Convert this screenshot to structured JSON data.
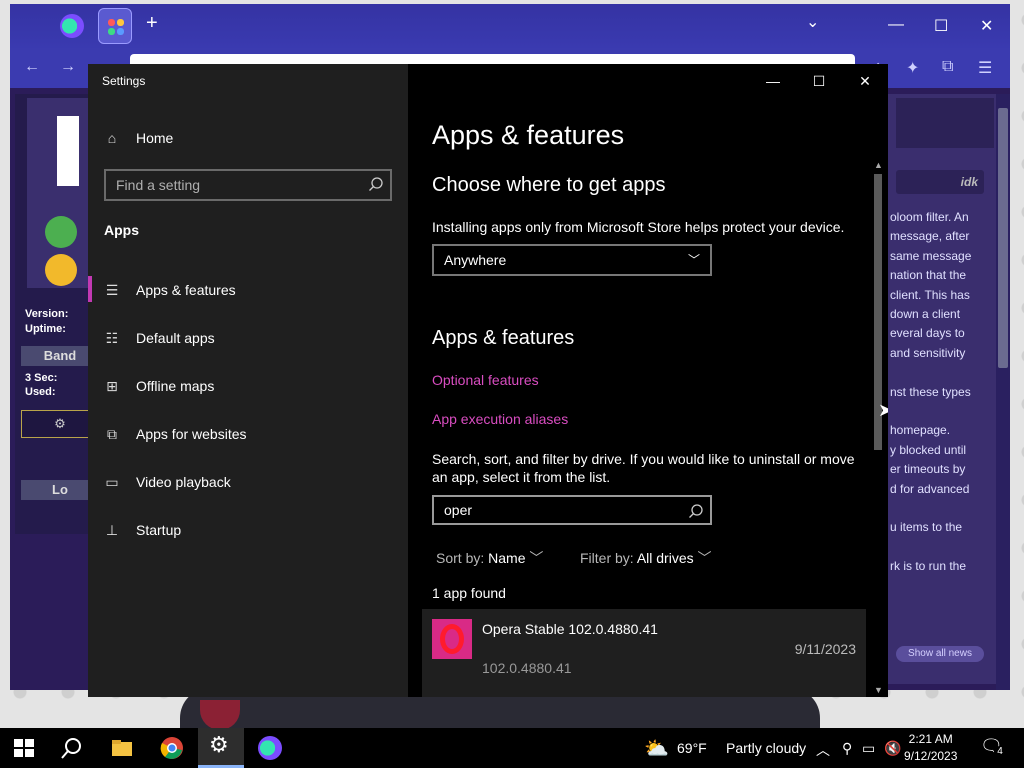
{
  "browser": {
    "tab_new": "+",
    "controls": {
      "tab_list": "⌄",
      "minimize": "—",
      "maximize": "☐",
      "close": "✕"
    },
    "sidebar": {
      "version_label": "Version:",
      "uptime_label": "Uptime:",
      "band_label": "Band",
      "sec_label": "3 Sec:",
      "used_label": "Used:",
      "lo_label": "Lo"
    },
    "right_panel": {
      "idk": "idk",
      "lines": [
        "oloom filter. An",
        "message, after",
        "same message",
        "nation that the",
        "client. This has",
        "down a client",
        "everal days to",
        " and sensitivity",
        "",
        "nst these types",
        "",
        "homepage.",
        "y blocked until",
        "er timeouts by",
        "d for advanced",
        "",
        "u items to the",
        "",
        "rk is to run the"
      ],
      "show_all": "Show all news"
    }
  },
  "settings": {
    "window_title": "Settings",
    "controls": {
      "minimize": "—",
      "maximize": "☐",
      "close": "✕"
    },
    "home_label": "Home",
    "search_placeholder": "Find a setting",
    "section_label": "Apps",
    "nav": [
      {
        "label": "Apps & features",
        "icon": "apps-features-icon",
        "glyph": "☰"
      },
      {
        "label": "Default apps",
        "icon": "default-apps-icon",
        "glyph": "☷"
      },
      {
        "label": "Offline maps",
        "icon": "offline-maps-icon",
        "glyph": "⊞"
      },
      {
        "label": "Apps for websites",
        "icon": "apps-websites-icon",
        "glyph": "⧉"
      },
      {
        "label": "Video playback",
        "icon": "video-playback-icon",
        "glyph": "▭"
      },
      {
        "label": "Startup",
        "icon": "startup-icon",
        "glyph": "⊥"
      }
    ],
    "content": {
      "title": "Apps & features",
      "choose_heading": "Choose where to get apps",
      "choose_desc": "Installing apps only from Microsoft Store helps protect your device.",
      "source_selected": "Anywhere",
      "af_heading": "Apps & features",
      "optional_features": "Optional features",
      "app_execution_aliases": "App execution aliases",
      "search_desc": "Search, sort, and filter by drive. If you would like to uninstall or move an app, select it from the list.",
      "search_value": "oper",
      "sort_label": "Sort by:",
      "sort_value": "Name",
      "filter_label": "Filter by:",
      "filter_value": "All drives",
      "count_text": "1 app found",
      "apps": [
        {
          "name": "Opera Stable 102.0.4880.41",
          "date": "9/11/2023",
          "version": "102.0.4880.41"
        }
      ]
    }
  },
  "taskbar": {
    "weather_temp": "69°F",
    "weather_desc": "Partly cloudy",
    "time": "2:21 AM",
    "date": "9/12/2023",
    "notification_count": "4"
  },
  "colors": {
    "accent": "#c239b3",
    "link": "#d94dc1",
    "sidebar_bg": "#1f1f1f",
    "browser_accent": "#3a3ab0"
  }
}
